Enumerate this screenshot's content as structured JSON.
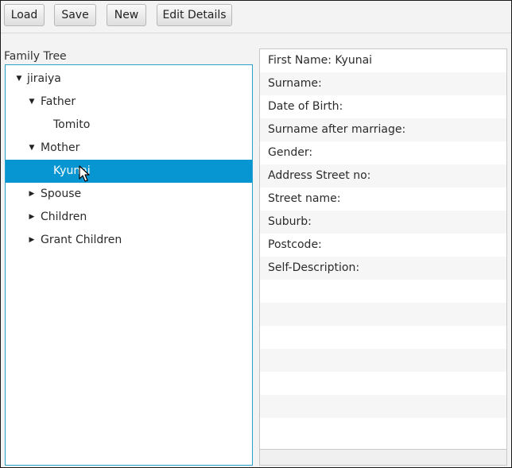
{
  "toolbar": {
    "load_label": "Load",
    "save_label": "Save",
    "new_label": "New",
    "edit_label": "Edit Details"
  },
  "tree": {
    "title": "Family Tree",
    "items": [
      {
        "label": "jiraiya",
        "expanded": true
      },
      {
        "label": "Father",
        "expanded": true
      },
      {
        "label": "Tomito"
      },
      {
        "label": "Mother",
        "expanded": true
      },
      {
        "label": "Kyunai",
        "selected": true
      },
      {
        "label": "Spouse",
        "expanded": false
      },
      {
        "label": "Children",
        "expanded": false
      },
      {
        "label": "Grant Children",
        "expanded": false
      }
    ]
  },
  "details": {
    "rows": [
      "First Name: Kyunai",
      "Surname:",
      "Date of Birth:",
      "Surname after marriage:",
      "Gender:",
      "Address Street no:",
      "Street name:",
      "Suburb:",
      "Postcode:",
      "Self-Description:"
    ]
  },
  "colors": {
    "selection": "#0896d2",
    "tree_border": "#2aa0cc"
  }
}
